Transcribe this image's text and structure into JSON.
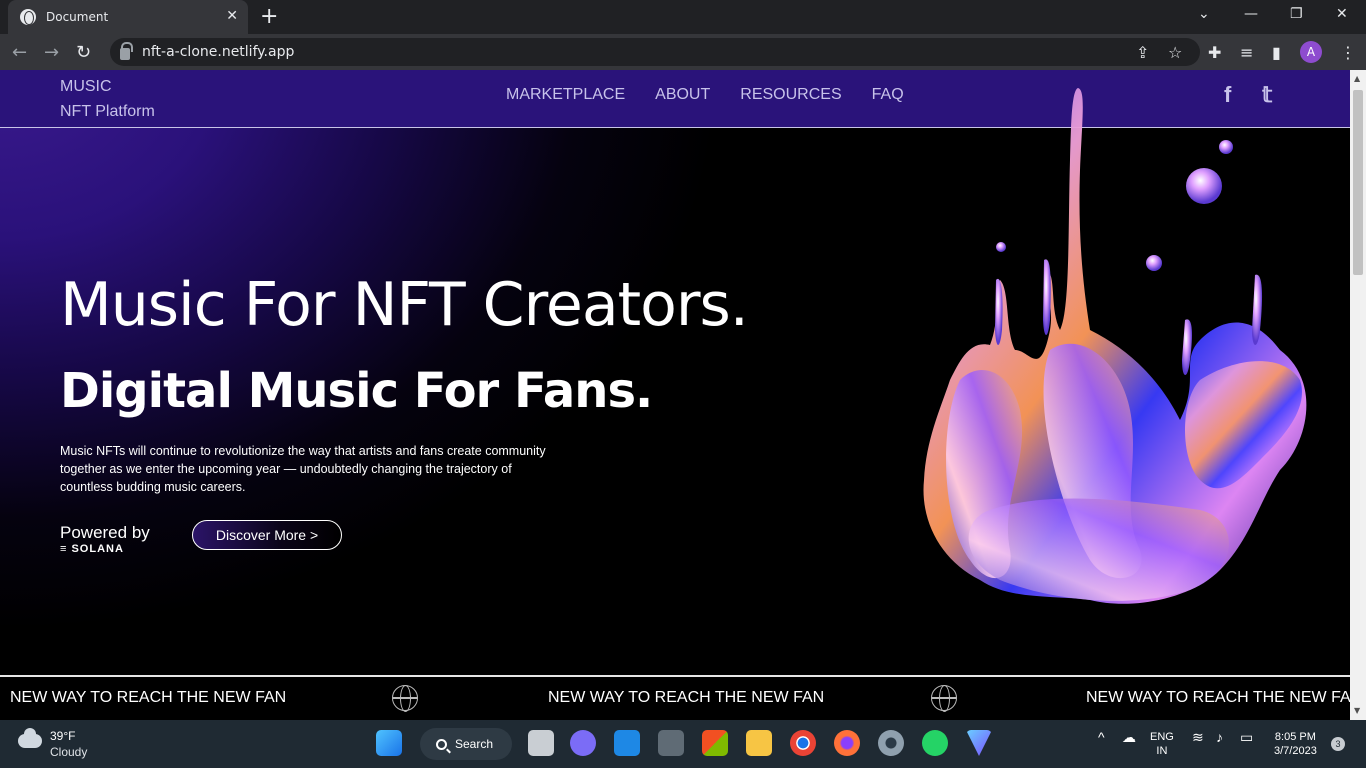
{
  "browser": {
    "tab_title": "Document",
    "tab_close": "✕",
    "new_tab": "+",
    "url": "nft-a-clone.netlify.app",
    "profile_initial": "A"
  },
  "site": {
    "logo_line1": "MUSIC",
    "logo_line2": "NFT Platform",
    "nav": [
      "MARKETPLACE",
      "ABOUT",
      "RESOURCES",
      "FAQ"
    ],
    "social": {
      "facebook": "f",
      "twitter": "𝕥"
    }
  },
  "hero": {
    "title": "Music For NFT Creators.",
    "subtitle": "Digital Music For Fans.",
    "description": "Music NFTs will continue to revolutionize the way that artists and fans create community together as we enter the upcoming year — undoubtedly changing the trajectory of countless budding music careers.",
    "powered_by": "Powered by",
    "powered_brand": "≡ SOLANA",
    "cta_label": "Discover More >"
  },
  "ticker": {
    "items": [
      "NEW WAY TO REACH THE NEW FAN",
      "NEW WAY TO REACH THE NEW FAN",
      "NEW WAY TO REACH THE NEW FAN"
    ]
  },
  "taskbar": {
    "temperature": "39°F",
    "condition": "Cloudy",
    "search_label": "Search",
    "language_line1": "ENG",
    "language_line2": "IN",
    "time": "8:05 PM",
    "date": "3/7/2023",
    "notification_count": "3"
  }
}
